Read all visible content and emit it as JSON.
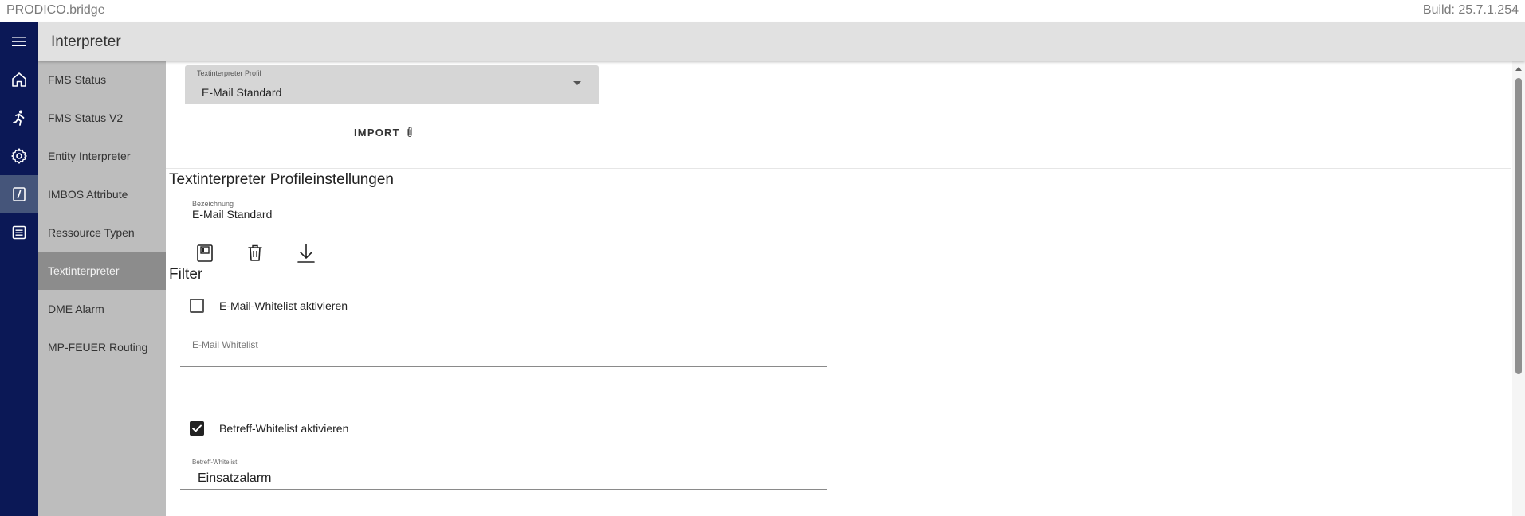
{
  "window": {
    "app_title": "PRODICO.bridge",
    "build": "Build: 25.7.1.254"
  },
  "rail": {
    "items": [
      {
        "icon": "menu-icon"
      },
      {
        "icon": "home-icon"
      },
      {
        "icon": "running-person-icon"
      },
      {
        "icon": "gear-icon"
      },
      {
        "icon": "interpreter-icon",
        "active": true
      },
      {
        "icon": "list-icon"
      }
    ]
  },
  "header": {
    "title": "Interpreter"
  },
  "subnav": {
    "items": [
      {
        "label": "FMS Status"
      },
      {
        "label": "FMS Status V2"
      },
      {
        "label": "Entity Interpreter"
      },
      {
        "label": "IMBOS Attribute"
      },
      {
        "label": "Ressource Typen"
      },
      {
        "label": "Textinterpreter",
        "active": true
      },
      {
        "label": "DME Alarm"
      },
      {
        "label": "MP-FEUER Routing"
      }
    ]
  },
  "profile_select": {
    "label": "Textinterpreter Profil",
    "value": "E-Mail Standard"
  },
  "import_button": {
    "label": "IMPORT",
    "icon": "paperclip-icon"
  },
  "settings": {
    "title": "Textinterpreter Profileinstellungen",
    "name_field": {
      "label": "Bezeichnung",
      "value": "E-Mail Standard"
    },
    "actions": [
      {
        "icon": "save-icon"
      },
      {
        "icon": "trash-icon"
      },
      {
        "icon": "download-icon"
      }
    ]
  },
  "filter": {
    "title": "Filter",
    "email_whitelist_checkbox": {
      "label": "E-Mail-Whitelist aktivieren",
      "checked": false
    },
    "email_whitelist_field": {
      "placeholder": "E-Mail Whitelist",
      "value": ""
    },
    "subject_whitelist_checkbox": {
      "label": "Betreff-Whitelist aktivieren",
      "checked": true
    },
    "subject_whitelist_field": {
      "label": "Betreff-Whitelist",
      "value": "Einsatzalarm"
    }
  },
  "colors": {
    "rail_bg": "#0b1856",
    "rail_active": "#45557a",
    "header_bg": "#e1e1e1",
    "subnav_bg": "#bdbdbd",
    "subnav_active": "#8c8c8c"
  }
}
